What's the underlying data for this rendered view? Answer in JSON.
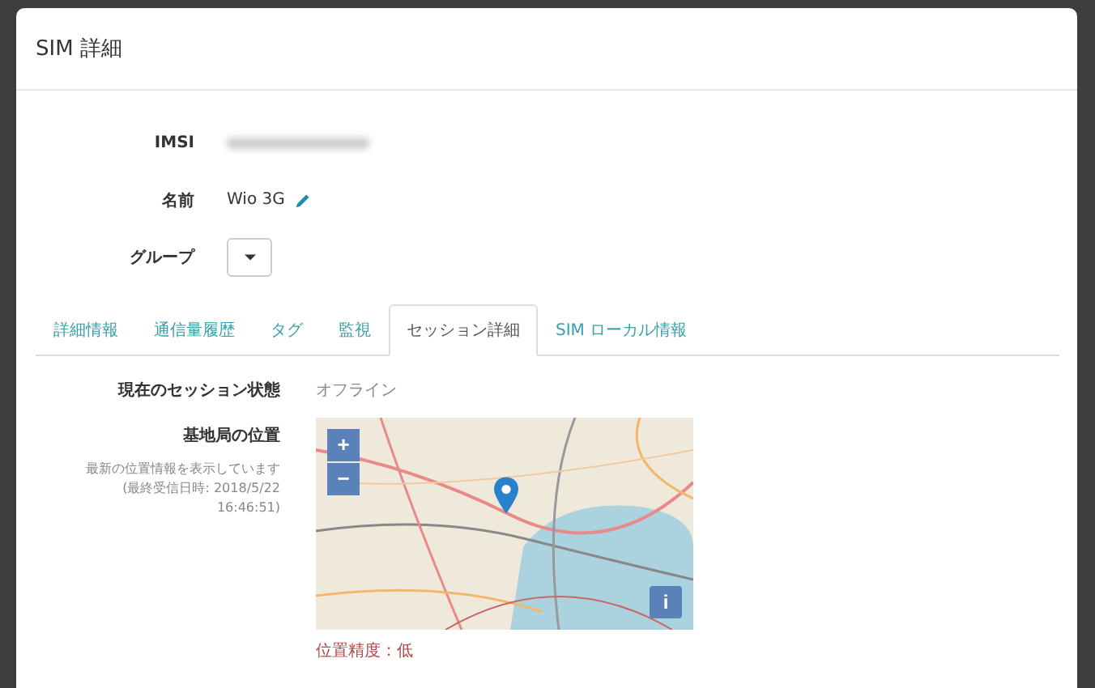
{
  "modal": {
    "title": "SIM 詳細"
  },
  "fields": [
    {
      "kind": "masked",
      "label": "IMSI"
    },
    {
      "kind": "editable",
      "label": "名前",
      "value": "Wio 3G"
    },
    {
      "kind": "dropdown",
      "label": "グループ"
    }
  ],
  "tabs": [
    {
      "label": "詳細情報",
      "selected": false
    },
    {
      "label": "通信量履歴",
      "selected": false
    },
    {
      "label": "タグ",
      "selected": false
    },
    {
      "label": "監視",
      "selected": false
    },
    {
      "label": "セッション詳細",
      "selected": true
    },
    {
      "label": "SIM ローカル情報",
      "selected": false
    }
  ],
  "session": {
    "status_label": "現在のセッション状態",
    "status_value": "オフライン",
    "location_label": "基地局の位置",
    "location_note": "最新の位置情報を表示しています",
    "received": "(最終受信日時: 2018/5/22 16:46:51)",
    "map": {
      "kind": "picture",
      "zoom_in": "+",
      "zoom_out": "−",
      "info": "i"
    },
    "accuracy": "位置精度：低"
  }
}
